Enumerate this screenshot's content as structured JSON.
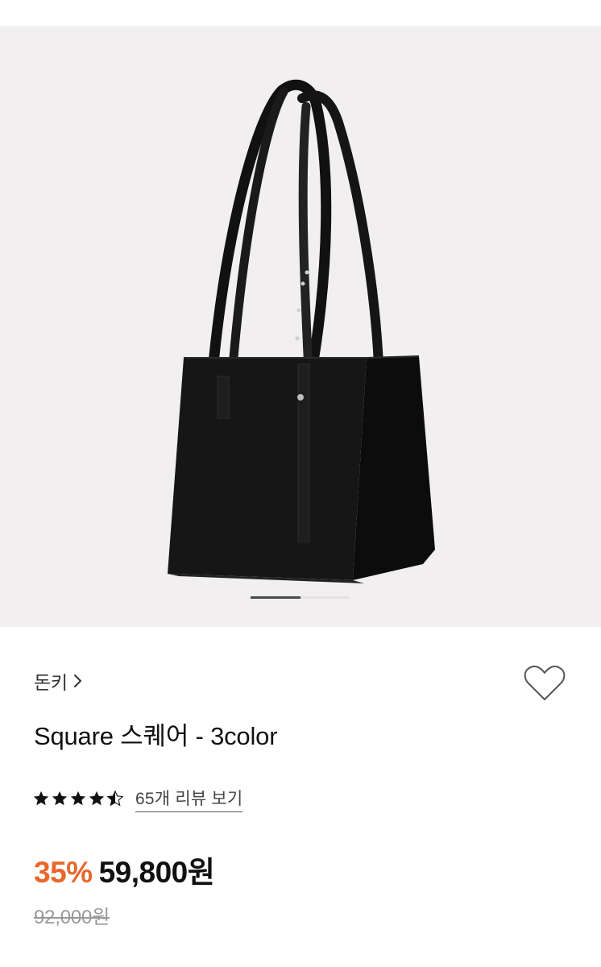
{
  "gallery": {
    "image_alt_icon": "black-square-tote-bag-image",
    "current_index": 1,
    "total_images": 2
  },
  "product": {
    "brand": "돈키",
    "brand_icon": "chevron-right-icon",
    "title": "Square 스퀘어 - 3color",
    "wish_icon": "heart-outline-icon"
  },
  "rating": {
    "value": 4.5,
    "max": 5,
    "review_link": "65개 리뷰 보기"
  },
  "price": {
    "discount": "35%",
    "sale_price": "59,800원",
    "original_price": "92,000원"
  },
  "colors": {
    "discount": "#e8672a",
    "star": "#111111",
    "background_gallery": "#f1eff0"
  }
}
